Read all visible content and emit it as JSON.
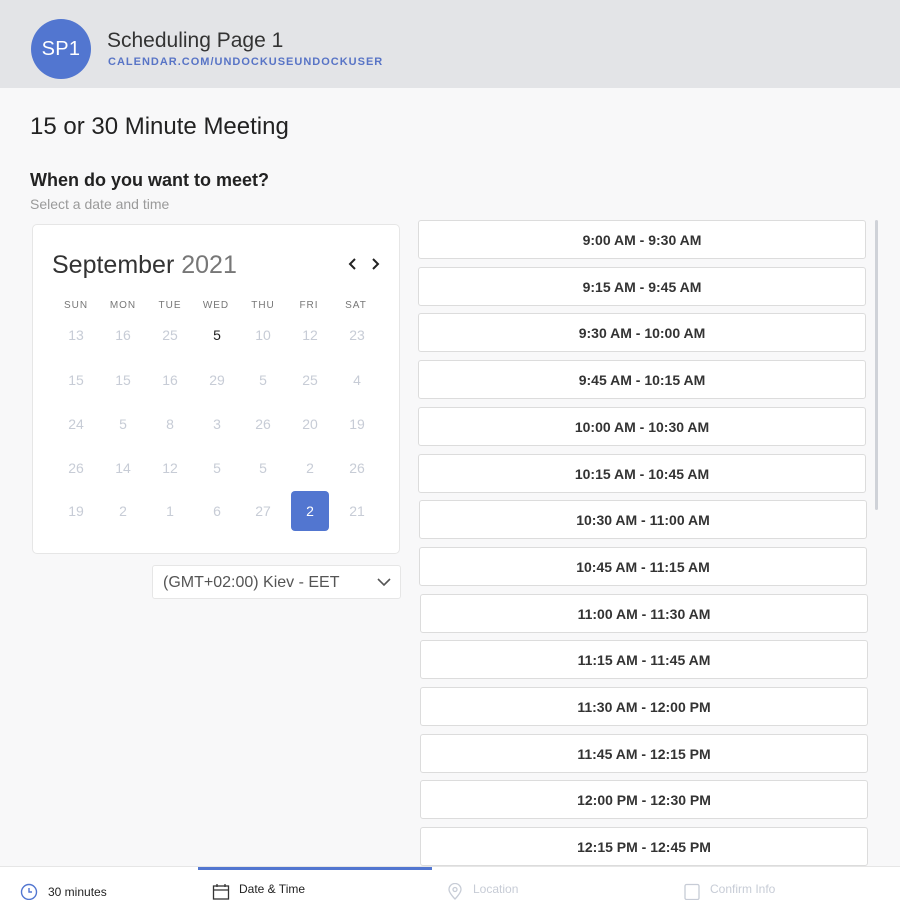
{
  "header": {
    "avatar_initials": "SP1",
    "title": "Scheduling Page 1",
    "url": "CALENDAR.COM/UNDOCKUSEUNDOCKUSER"
  },
  "meeting_title": "15 or 30 Minute Meeting",
  "prompt": {
    "heading": "When do you want to meet?",
    "subheading": "Select a date and time"
  },
  "calendar": {
    "month": "September",
    "year": "2021",
    "weekdays": [
      "SUN",
      "MON",
      "TUE",
      "WED",
      "THU",
      "FRI",
      "SAT"
    ],
    "weeks": [
      [
        "13",
        "16",
        "25",
        "5",
        "10",
        "12",
        "23"
      ],
      [
        "15",
        "15",
        "16",
        "29",
        "5",
        "25",
        "4"
      ],
      [
        "24",
        "5",
        "8",
        "3",
        "26",
        "20",
        "19"
      ],
      [
        "26",
        "14",
        "12",
        "5",
        "5",
        "2",
        "26"
      ],
      [
        "19",
        "2",
        "1",
        "6",
        "27",
        "2",
        "21"
      ]
    ],
    "available_day": "5",
    "selected_day": "2"
  },
  "timezone": {
    "value": "(GMT+02:00) Kiev - EET"
  },
  "time_slots": [
    "9:00 AM - 9:30 AM",
    "9:15 AM - 9:45 AM",
    "9:30 AM - 10:00 AM",
    "9:45 AM - 10:15 AM",
    "10:00 AM - 10:30 AM",
    "10:15 AM - 10:45 AM",
    "10:30 AM - 11:00 AM",
    "10:45 AM - 11:15 AM",
    "11:00 AM - 11:30 AM",
    "11:15 AM - 11:45 AM",
    "11:30 AM - 12:00 PM",
    "11:45 AM - 12:15 PM",
    "12:00 PM - 12:30 PM",
    "12:15 PM - 12:45 PM"
  ],
  "steps": [
    {
      "label": "30 minutes",
      "icon": "clock-icon",
      "state": "done"
    },
    {
      "label": "Date & Time",
      "icon": "calendar-icon",
      "state": "current"
    },
    {
      "label": "Location",
      "icon": "location-pin-icon",
      "state": "upcoming"
    },
    {
      "label": "Confirm Info",
      "icon": "document-icon",
      "state": "upcoming"
    }
  ],
  "colors": {
    "accent": "#5276d0",
    "header_bg": "#e3e4e7",
    "url_text": "#5874c6",
    "muted_day": "#c7ccd6",
    "page_bg": "#f8f8f9"
  }
}
